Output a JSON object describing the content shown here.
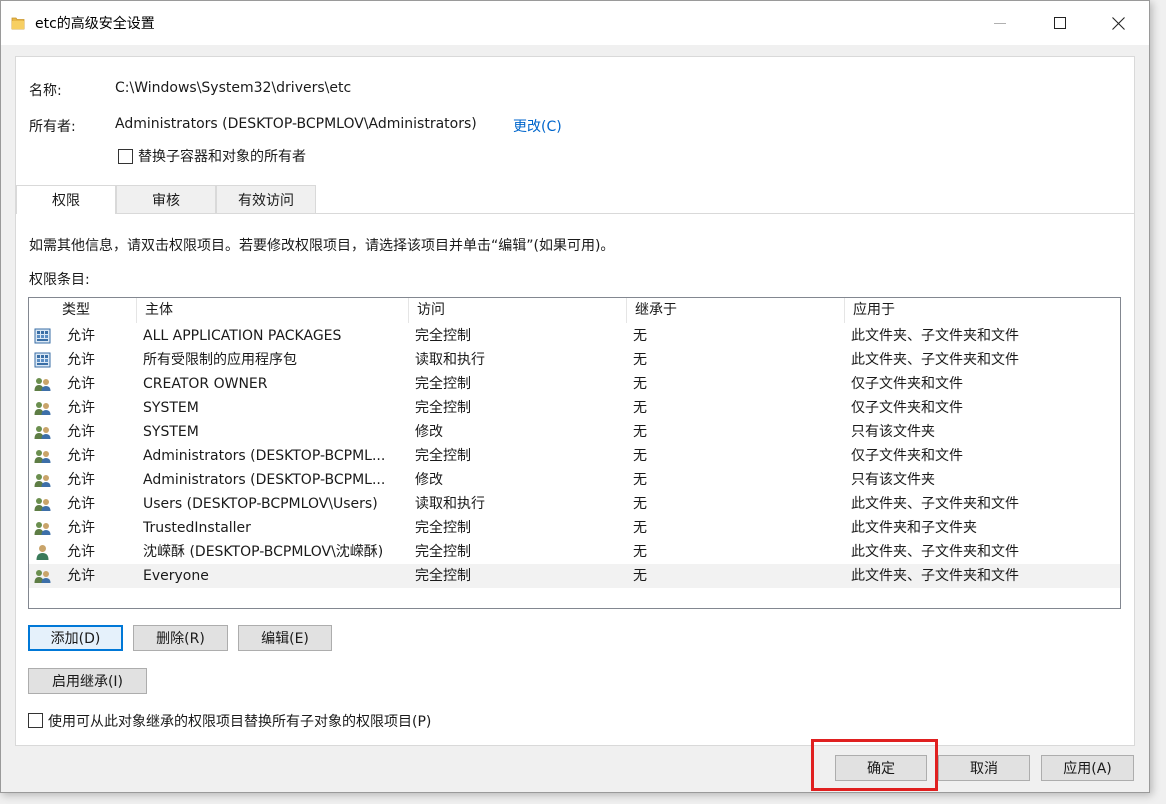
{
  "window": {
    "title": "etc的高级安全设置",
    "accent": "#0078d7",
    "highlight_color": "#e02020"
  },
  "info": {
    "name_label": "名称:",
    "name_value": "C:\\Windows\\System32\\drivers\\etc",
    "owner_label": "所有者:",
    "owner_value": "Administrators (DESKTOP-BCPMLOV\\Administrators)",
    "change_link": "更改(C)",
    "replace_owner_checkbox": "替换子容器和对象的所有者"
  },
  "tabs": [
    {
      "label": "权限",
      "active": true
    },
    {
      "label": "审核",
      "active": false
    },
    {
      "label": "有效访问",
      "active": false
    }
  ],
  "permissions": {
    "hint": "如需其他信息，请双击权限项目。若要修改权限项目，请选择该项目并单击“编辑”(如果可用)。",
    "entries_label": "权限条目:",
    "columns": [
      "类型",
      "主体",
      "访问",
      "继承于",
      "应用于"
    ],
    "rows": [
      {
        "icon": "app-package-icon",
        "type": "允许",
        "principal": "ALL APPLICATION PACKAGES",
        "access": "完全控制",
        "inherited": "无",
        "applies": "此文件夹、子文件夹和文件"
      },
      {
        "icon": "app-package-icon",
        "type": "允许",
        "principal": "所有受限制的应用程序包",
        "access": "读取和执行",
        "inherited": "无",
        "applies": "此文件夹、子文件夹和文件"
      },
      {
        "icon": "user-group-icon",
        "type": "允许",
        "principal": "CREATOR OWNER",
        "access": "完全控制",
        "inherited": "无",
        "applies": "仅子文件夹和文件"
      },
      {
        "icon": "user-group-icon",
        "type": "允许",
        "principal": "SYSTEM",
        "access": "完全控制",
        "inherited": "无",
        "applies": "仅子文件夹和文件"
      },
      {
        "icon": "user-group-icon",
        "type": "允许",
        "principal": "SYSTEM",
        "access": "修改",
        "inherited": "无",
        "applies": "只有该文件夹"
      },
      {
        "icon": "user-group-icon",
        "type": "允许",
        "principal": "Administrators (DESKTOP-BCPML...",
        "access": "完全控制",
        "inherited": "无",
        "applies": "仅子文件夹和文件"
      },
      {
        "icon": "user-group-icon",
        "type": "允许",
        "principal": "Administrators (DESKTOP-BCPML...",
        "access": "修改",
        "inherited": "无",
        "applies": "只有该文件夹"
      },
      {
        "icon": "user-group-icon",
        "type": "允许",
        "principal": "Users (DESKTOP-BCPMLOV\\Users)",
        "access": "读取和执行",
        "inherited": "无",
        "applies": "此文件夹、子文件夹和文件"
      },
      {
        "icon": "user-group-icon",
        "type": "允许",
        "principal": "TrustedInstaller",
        "access": "完全控制",
        "inherited": "无",
        "applies": "此文件夹和子文件夹"
      },
      {
        "icon": "user-icon",
        "type": "允许",
        "principal": "沈嵘酥 (DESKTOP-BCPMLOV\\沈嵘酥)",
        "access": "完全控制",
        "inherited": "无",
        "applies": "此文件夹、子文件夹和文件"
      },
      {
        "icon": "user-group-icon",
        "type": "允许",
        "principal": "Everyone",
        "access": "完全控制",
        "inherited": "无",
        "applies": "此文件夹、子文件夹和文件",
        "selected": true
      }
    ]
  },
  "buttons": {
    "add": "添加(D)",
    "remove": "删除(R)",
    "edit": "编辑(E)",
    "enable_inheritance": "启用继承(I)",
    "replace_child_checkbox": "使用可从此对象继承的权限项目替换所有子对象的权限项目(P)",
    "ok": "确定",
    "cancel": "取消",
    "apply": "应用(A)"
  }
}
